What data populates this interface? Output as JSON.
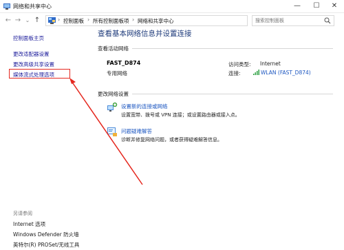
{
  "window": {
    "title": "网络和共享中心",
    "controls": {
      "minimize": "—",
      "maximize": "☐",
      "close": "✕"
    }
  },
  "address_bar": {
    "back": "←",
    "forward": "→",
    "recent": "⌄",
    "up": "↑",
    "breadcrumbs": [
      "控制面板",
      "所有控制面板项",
      "网络和共享中心"
    ],
    "separator": "›",
    "dropdown": "⌄",
    "refresh": "↻",
    "search_placeholder": "搜索控制面板"
  },
  "sidebar": {
    "home": "控制面板主页",
    "links": [
      "更改适配器设置",
      "更改高级共享设置",
      "媒体流式处理选项"
    ],
    "see_also_heading": "另请参阅",
    "see_also": [
      "Internet 选项",
      "Windows Defender 防火墙",
      "英特尔(R) PROSet/无线工具"
    ]
  },
  "main": {
    "title": "查看基本网络信息并设置连接",
    "active_networks_label": "查看活动网络",
    "network": {
      "name": "FAST_D874",
      "type": "专用网络",
      "access_type_label": "访问类型:",
      "access_type_value": "Internet",
      "connection_label": "连接:",
      "connection_value": "WLAN (FAST_D874)"
    },
    "change_settings_label": "更改网络设置",
    "tasks": [
      {
        "icon": "new-connection-icon",
        "title": "设置新的连接或网络",
        "desc": "设置宽带、拨号或 VPN 连接；或设置路由器或接入点。"
      },
      {
        "icon": "troubleshoot-icon",
        "title": "问题疑难解答",
        "desc": "诊断并修复网络问题，或者获得疑难解答信息。"
      }
    ]
  },
  "colors": {
    "link": "#1a55c0",
    "title": "#1d3a7a",
    "highlight": "#e5281f"
  }
}
